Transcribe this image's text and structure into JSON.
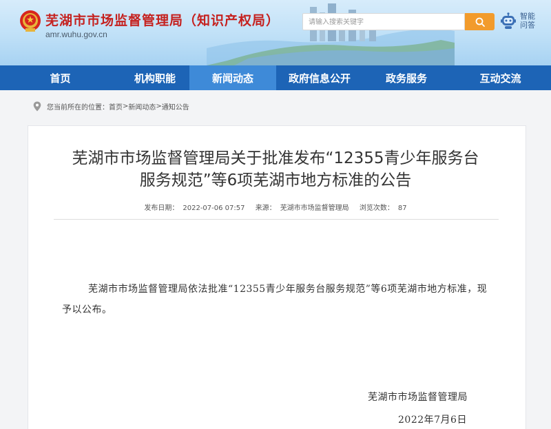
{
  "header": {
    "site_title": "芜湖市市场监督管理局（知识产权局）",
    "domain": "amr.wuhu.gov.cn",
    "search_placeholder": "请输入搜索关键字",
    "assistant_label": "智能问答",
    "brand_color": "#c5211f",
    "search_button_color": "#f29b2c",
    "icons": [
      "national-emblem-icon",
      "search-icon",
      "robot-icon"
    ]
  },
  "nav": {
    "items": [
      {
        "label": "首页"
      },
      {
        "label": "机构职能"
      },
      {
        "label": "新闻动态"
      },
      {
        "label": "政府信息公开"
      },
      {
        "label": "政务服务"
      },
      {
        "label": "互动交流"
      }
    ],
    "active": "新闻动态",
    "bar_color": "#1d64b6",
    "active_color": "#3e8ad8"
  },
  "breadcrumb": {
    "prefix": "您当前所在的位置：",
    "items": [
      "首页",
      "新闻动态",
      "通知公告"
    ],
    "separator": " > ",
    "icon": "location-pin-icon"
  },
  "article": {
    "title_line1": "芜湖市市场监督管理局关于批准发布“12355青少年服务台",
    "title_line2": "服务规范”等6项芜湖市地方标准的公告",
    "published_label": "发布日期：",
    "published": "2022-07-06 07:57",
    "source_label": "来源：",
    "source": "芜湖市市场监督管理局",
    "views_label": "浏览次数：",
    "views": "87",
    "body": "芜湖市市场监督管理局依法批准“12355青少年服务台服务规范”等6项芜湖市地方标准，现予以公布。",
    "signature_org": "芜湖市市场监督管理局",
    "signature_date": "2022年7月6日"
  }
}
